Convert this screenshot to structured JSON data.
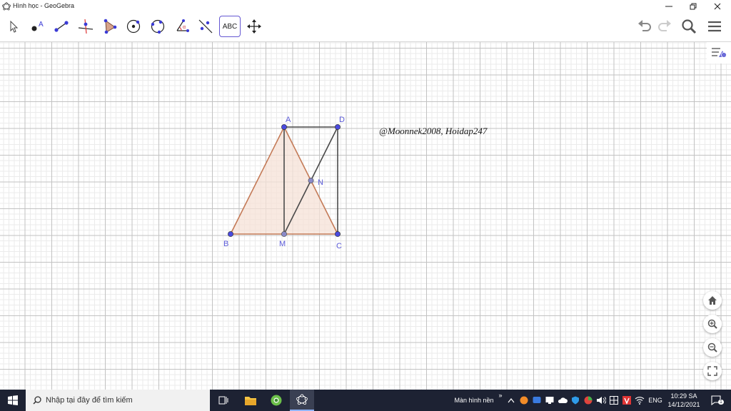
{
  "window": {
    "title": "Hình học - GeoGebra"
  },
  "toolbar": {
    "tools": [
      "move-tool",
      "point-tool",
      "segment-tool",
      "perpendicular-line-tool",
      "polygon-tool",
      "circle-center-point-tool",
      "circle-three-points-tool",
      "angle-tool",
      "reflect-tool",
      "text-tool",
      "move-graphics-view-tool"
    ],
    "text_tool_label": "ABC"
  },
  "construction": {
    "points": {
      "A": "A",
      "B": "B",
      "C": "C",
      "D": "D",
      "M": "M",
      "N": "N"
    },
    "watermark": "@Moonnek2008, Hoidap247",
    "colors": {
      "triangle_fill": "#f6e1d7",
      "triangle_stroke": "#c47a57",
      "segment": "#4a4a4a",
      "point": "#4a4adf",
      "label": "#5a5ad8"
    }
  },
  "taskbar": {
    "search_placeholder": "Nhập tại đây để tìm kiếm",
    "desktop_label": "Màn hình nền",
    "language": "ENG",
    "time": "10:29 SA",
    "date": "14/12/2021",
    "notification_count": "1"
  }
}
